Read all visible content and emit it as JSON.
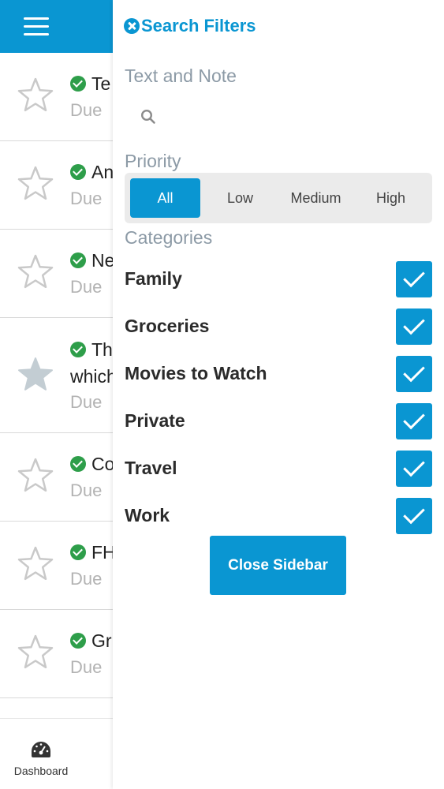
{
  "tasks": [
    {
      "title": "Te",
      "due": "Due",
      "starred": false
    },
    {
      "title": "An",
      "due": "Due",
      "starred": false
    },
    {
      "title": "Ne",
      "due": "Due",
      "starred": false
    },
    {
      "title": "Th",
      "line2": "which",
      "due": "Due",
      "starred": true
    },
    {
      "title": "Co",
      "due": "Due",
      "starred": false
    },
    {
      "title": "FH",
      "due": "Due",
      "starred": false
    },
    {
      "title": "Gr",
      "due": "Due",
      "starred": false
    }
  ],
  "bottom_nav": {
    "dashboard_label": "Dashboard"
  },
  "sidebar": {
    "title": "Search Filters",
    "text_note_label": "Text and Note",
    "search_value": "",
    "priority_label": "Priority",
    "priority_options": [
      "All",
      "Low",
      "Medium",
      "High"
    ],
    "priority_selected": "All",
    "categories_label": "Categories",
    "categories": [
      {
        "name": "Family",
        "checked": true
      },
      {
        "name": "Groceries",
        "checked": true
      },
      {
        "name": "Movies to Watch",
        "checked": true
      },
      {
        "name": "Private",
        "checked": true
      },
      {
        "name": "Travel",
        "checked": true
      },
      {
        "name": "Work",
        "checked": true
      }
    ],
    "close_button_label": "Close Sidebar"
  },
  "colors": {
    "accent": "#0a96d2",
    "check_green": "#2e9e4a",
    "muted_text": "#8c9aa6"
  }
}
